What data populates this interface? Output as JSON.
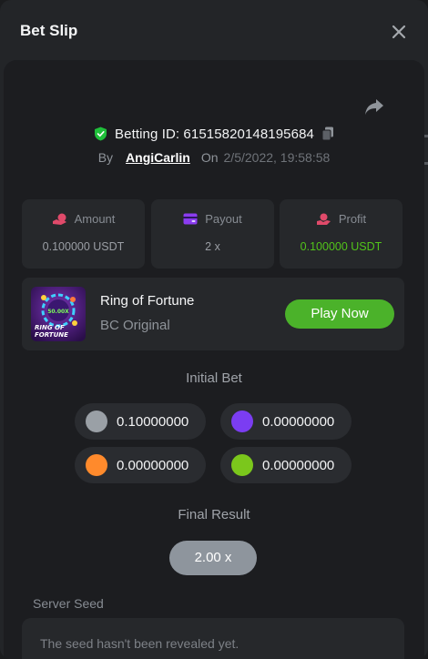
{
  "window": {
    "title": "Bet Slip"
  },
  "bet": {
    "id_label": "Betting ID: 61515820148195684",
    "by_label": "By",
    "username": "AngiCarlin",
    "on_label": "On",
    "datetime": "2/5/2022, 19:58:58"
  },
  "stats": [
    {
      "label": "Amount",
      "value": "0.100000 USDT",
      "icon": "coins-hand-icon"
    },
    {
      "label": "Payout",
      "value": "2 x",
      "icon": "wallet-card-icon"
    },
    {
      "label": "Profit",
      "value": "0.100000 USDT",
      "icon": "money-hand-icon"
    }
  ],
  "game": {
    "name": "Ring of Fortune",
    "category": "BC Original",
    "play_label": "Play Now",
    "thumb_text_1": "RING OF",
    "thumb_text_2": "FORTUNE",
    "thumb_multiplier": "50.00X"
  },
  "initial_bet": {
    "title": "Initial Bet",
    "chips": [
      {
        "color": "#9aa0a6",
        "value": "0.10000000"
      },
      {
        "color": "#7b3df2",
        "value": "0.00000000"
      },
      {
        "color": "#ff8a2c",
        "value": "0.00000000"
      },
      {
        "color": "#7bc71c",
        "value": "0.00000000"
      }
    ]
  },
  "final_result": {
    "title": "Final Result",
    "value": "2.00 x"
  },
  "server_seed": {
    "label": "Server Seed",
    "text": "The seed hasn't been revealed yet."
  },
  "colors": {
    "accent_green": "#4bb22a",
    "profit_green": "#52c41a",
    "verified_green": "#1fbf3a",
    "icon_pink": "#e04a6a",
    "icon_purple": "#8b3cf0"
  }
}
